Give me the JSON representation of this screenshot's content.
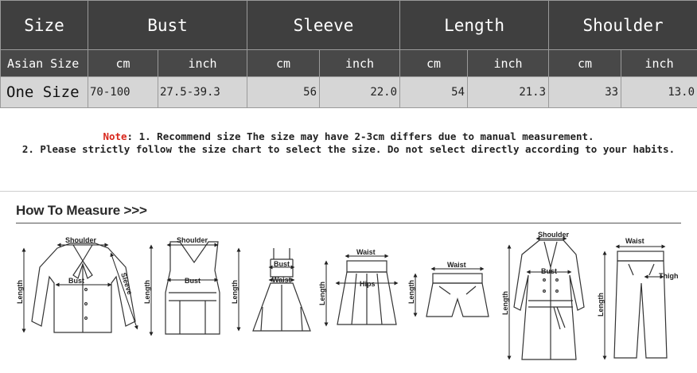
{
  "table": {
    "headers": [
      "Size",
      "Bust",
      "Sleeve",
      "Length",
      "Shoulder"
    ],
    "units_label": "Asian Size",
    "units": [
      "cm",
      "inch",
      "cm",
      "inch",
      "cm",
      "inch",
      "cm",
      "inch"
    ],
    "row_label": "One Size",
    "values": [
      "70-100",
      "27.5-39.3",
      "56",
      "22.0",
      "54",
      "21.3",
      "33",
      "13.0"
    ]
  },
  "note": {
    "label": "Note",
    "line1": ": 1. Recommend size  The size may have 2-3cm differs due to manual measurement.",
    "line2": "2. Please strictly follow the size chart to select the size. Do not select directly according to your habits."
  },
  "measure": {
    "title": "How To Measure >>>",
    "labels": {
      "shoulder": "Shoulder",
      "bust": "Bust",
      "sleeve": "Sleeve",
      "length": "Length",
      "waist": "Waist",
      "hips": "Hips",
      "thigh": "Thigh"
    }
  }
}
